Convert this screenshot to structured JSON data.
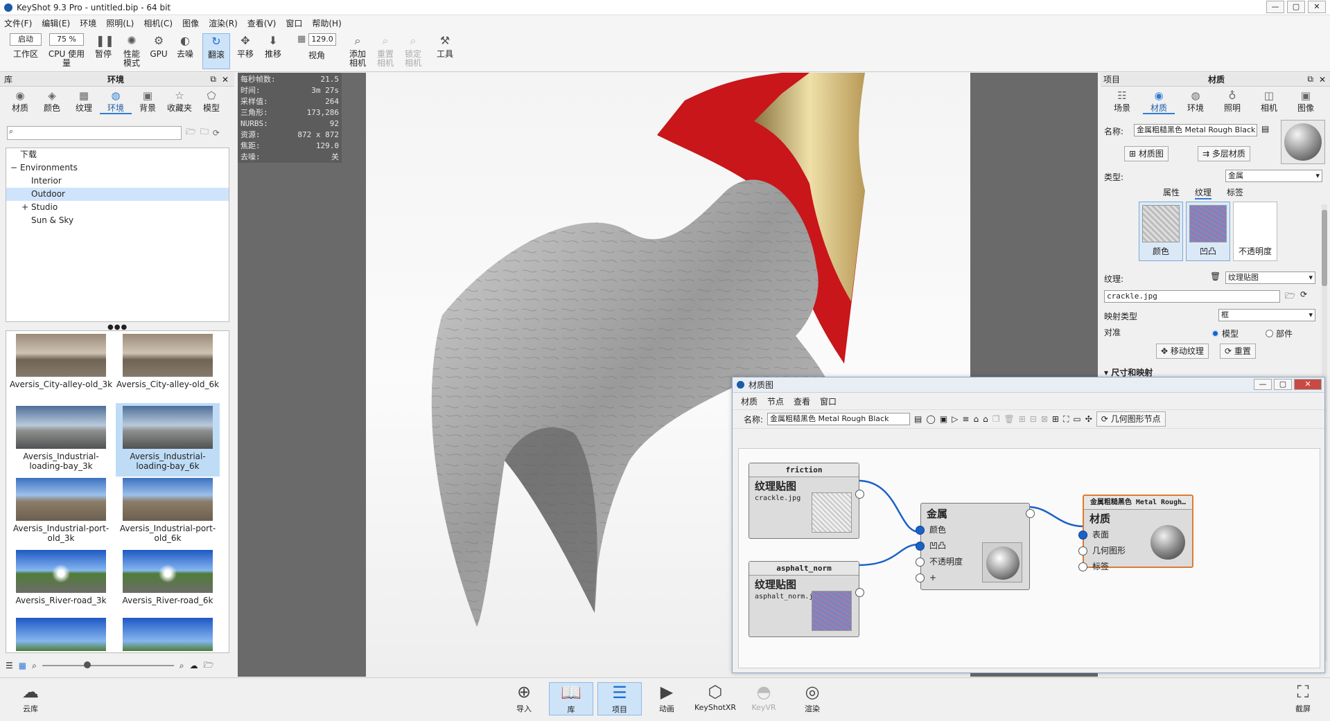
{
  "window": {
    "title": "KeyShot 9.3 Pro - untitled.bip - 64 bit",
    "controls": [
      "—",
      "▢",
      "✕"
    ]
  },
  "menu": [
    "文件(F)",
    "编辑(E)",
    "环境",
    "照明(L)",
    "相机(C)",
    "图像",
    "渲染(R)",
    "查看(V)",
    "窗口",
    "帮助(H)"
  ],
  "toolbar": {
    "workspace_combo": "启动",
    "workspace_label": "工作区",
    "cpu_combo": "75 %",
    "cpu_label": "CPU 使用量",
    "pause_label": "暂停",
    "perf_label1": "性能",
    "perf_label2": "模式",
    "gpu_label": "GPU",
    "denoise_label": "去噪",
    "tumble_label": "翻滚",
    "pan_label": "平移",
    "dolly_label": "推移",
    "fov_value": "129.0",
    "fov_label": "视角",
    "add_cam_label1": "添加",
    "add_cam_label2": "相机",
    "reset_cam_label1": "重置",
    "reset_cam_label2": "相机",
    "lock_cam_label1": "锁定",
    "lock_cam_label2": "相机",
    "tools_label": "工具"
  },
  "library": {
    "header_left": "库",
    "header_title": "环境",
    "tabs": [
      {
        "label": "材质",
        "icon": "material-icon"
      },
      {
        "label": "颜色",
        "icon": "color-icon"
      },
      {
        "label": "纹理",
        "icon": "texture-icon"
      },
      {
        "label": "环境",
        "icon": "environment-icon"
      },
      {
        "label": "背景",
        "icon": "background-icon"
      },
      {
        "label": "收藏夹",
        "icon": "favorites-icon"
      },
      {
        "label": "模型",
        "icon": "model-icon"
      }
    ],
    "search_placeholder": "",
    "tree": [
      {
        "label": "下载",
        "indent": 0
      },
      {
        "label": "Environments",
        "indent": 0
      },
      {
        "label": "Interior",
        "indent": 1
      },
      {
        "label": "Outdoor",
        "indent": 1
      },
      {
        "label": "Studio",
        "indent": 1
      },
      {
        "label": "Sun & Sky",
        "indent": 1
      }
    ],
    "thumbs": [
      {
        "label": "Aversis_City-alley-old_3k",
        "kind": "city"
      },
      {
        "label": "Aversis_City-alley-old_6k",
        "kind": "city"
      },
      {
        "label": "Aversis_Industrial-loading-bay_3k",
        "kind": "industrial"
      },
      {
        "label": "Aversis_Industrial-loading-bay_6k",
        "kind": "industrial"
      },
      {
        "label": "Aversis_Industrial-port-old_3k",
        "kind": "port"
      },
      {
        "label": "Aversis_Industrial-port-old_6k",
        "kind": "port"
      },
      {
        "label": "Aversis_River-road_3k",
        "kind": "road"
      },
      {
        "label": "Aversis_River-road_6k",
        "kind": "road"
      }
    ]
  },
  "stats": [
    {
      "k": "每秒帧数:",
      "v": "21.5"
    },
    {
      "k": "时间:",
      "v": "3m 27s"
    },
    {
      "k": "采样值:",
      "v": "264"
    },
    {
      "k": "三角形:",
      "v": "173,286"
    },
    {
      "k": "NURBS:",
      "v": "92"
    },
    {
      "k": "资源:",
      "v": "872 x 872"
    },
    {
      "k": "焦距:",
      "v": "129.0"
    },
    {
      "k": "去噪:",
      "v": "关"
    }
  ],
  "project": {
    "header_left": "项目",
    "header_title": "材质",
    "tabs": [
      "场景",
      "材质",
      "环境",
      "照明",
      "相机",
      "图像"
    ],
    "name_label": "名称:",
    "name_value": "金属粗糙黑色 Metal Rough Black",
    "material_graph_btn": "材质图",
    "multi_material_btn": "多层材质",
    "type_label": "类型:",
    "type_value": "金属",
    "subtabs": [
      "属性",
      "纹理",
      "标签"
    ],
    "channels": [
      "颜色",
      "凹凸",
      "不透明度"
    ],
    "texture_label": "纹理:",
    "texture_value": "纹理贴图",
    "file_value": "crackle.jpg",
    "mapping_label": "映射类型",
    "mapping_value": "框",
    "align_label": "对准",
    "align_model": "模型",
    "align_part": "部件",
    "move_texture_btn": "移动纹理",
    "reset_btn": "重置",
    "size_section": "尺寸和映射"
  },
  "graph": {
    "title": "材质图",
    "menu": [
      "材质",
      "节点",
      "查看",
      "窗口"
    ],
    "name_label": "名称:",
    "name_value": "金属粗糙黑色 Metal Rough Black",
    "geometry_node_btn": "几何图形节点",
    "nodes": {
      "friction": {
        "head": "friction",
        "title": "纹理贴图",
        "file": "crackle.jpg"
      },
      "asphalt": {
        "head": "asphalt_norm",
        "title": "纹理贴图",
        "file": "asphalt_norm.jpg"
      },
      "metal": {
        "title": "金属",
        "ports": [
          "颜色",
          "凹凸",
          "不透明度",
          "+"
        ]
      },
      "output": {
        "head": "金属粗糙黑色 Metal Rough…",
        "title": "材质",
        "ports": [
          "表面",
          "几何图形",
          "标签"
        ]
      }
    }
  },
  "bottom": {
    "cloud_label": "云库",
    "buttons": [
      "导入",
      "库",
      "项目",
      "动画",
      "KeyShotXR",
      "KeyVR",
      "渲染"
    ],
    "screenshot_label": "截屏"
  }
}
